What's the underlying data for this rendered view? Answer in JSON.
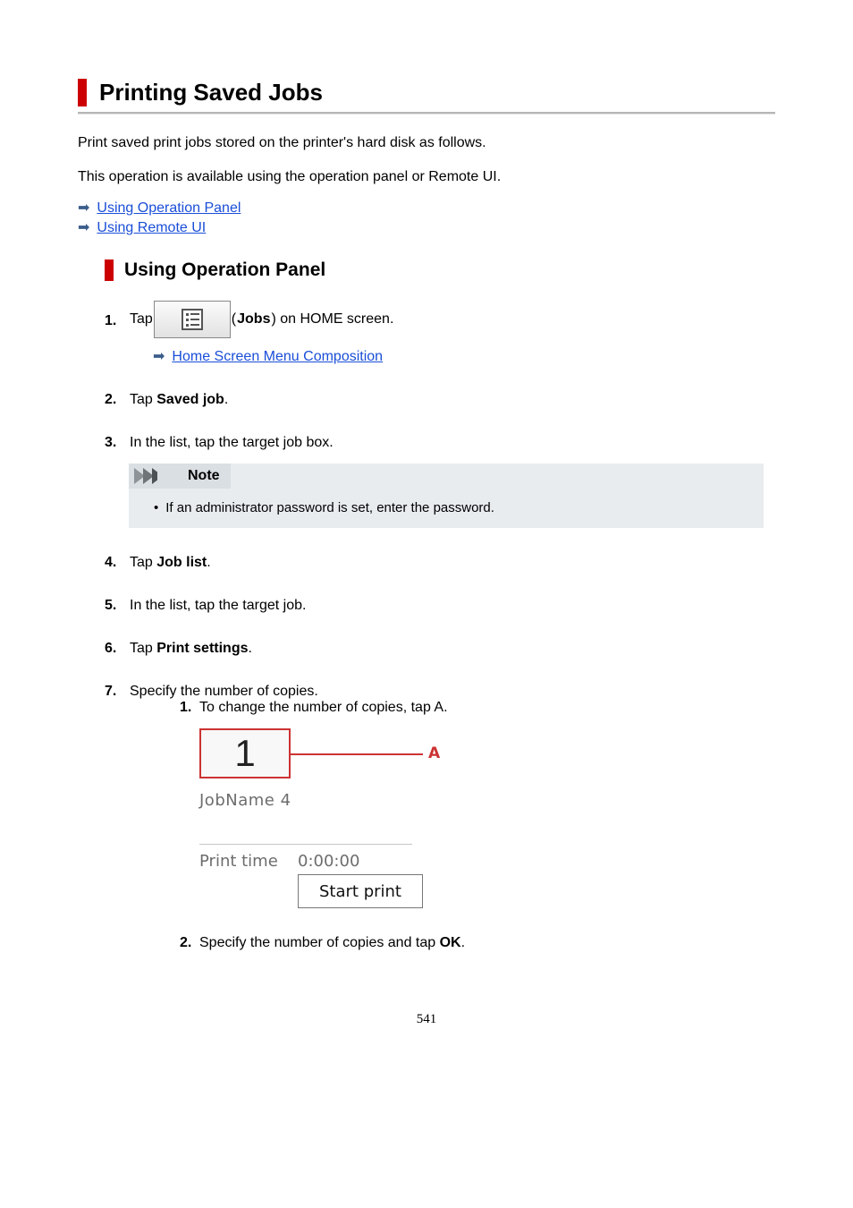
{
  "h1": "Printing Saved Jobs",
  "intro1": "Print saved print jobs stored on the printer's hard disk as follows.",
  "intro2": "This operation is available using the operation panel or Remote UI.",
  "links": {
    "op_panel": "Using Operation Panel",
    "remote_ui": "Using Remote UI"
  },
  "h2": "Using Operation Panel",
  "step1": {
    "prefix": "Tap ",
    "suffix1": " (",
    "bold": "Jobs",
    "suffix2": ") on HOME screen."
  },
  "step1_link": "Home Screen Menu Composition",
  "step2": {
    "prefix": "Tap ",
    "bold": "Saved job",
    "suffix": "."
  },
  "step3": "In the list, tap the target job box.",
  "note_title": "Note",
  "note_body": "If an administrator password is set, enter the password.",
  "step4": {
    "prefix": "Tap ",
    "bold": "Job list",
    "suffix": "."
  },
  "step5": "In the list, tap the target job.",
  "step6": {
    "prefix": "Tap ",
    "bold": "Print settings",
    "suffix": "."
  },
  "step7": "Specify the number of copies.",
  "sub1": "To change the number of copies, tap A.",
  "device": {
    "copies": "1",
    "jobname": "JobName 4",
    "print_time_label": "Print time",
    "print_time_value": "0:00:00",
    "start_btn": "Start print",
    "marker": "A"
  },
  "sub2": {
    "prefix": "Specify the number of copies and tap ",
    "bold": "OK",
    "suffix": "."
  },
  "page_num": "541"
}
